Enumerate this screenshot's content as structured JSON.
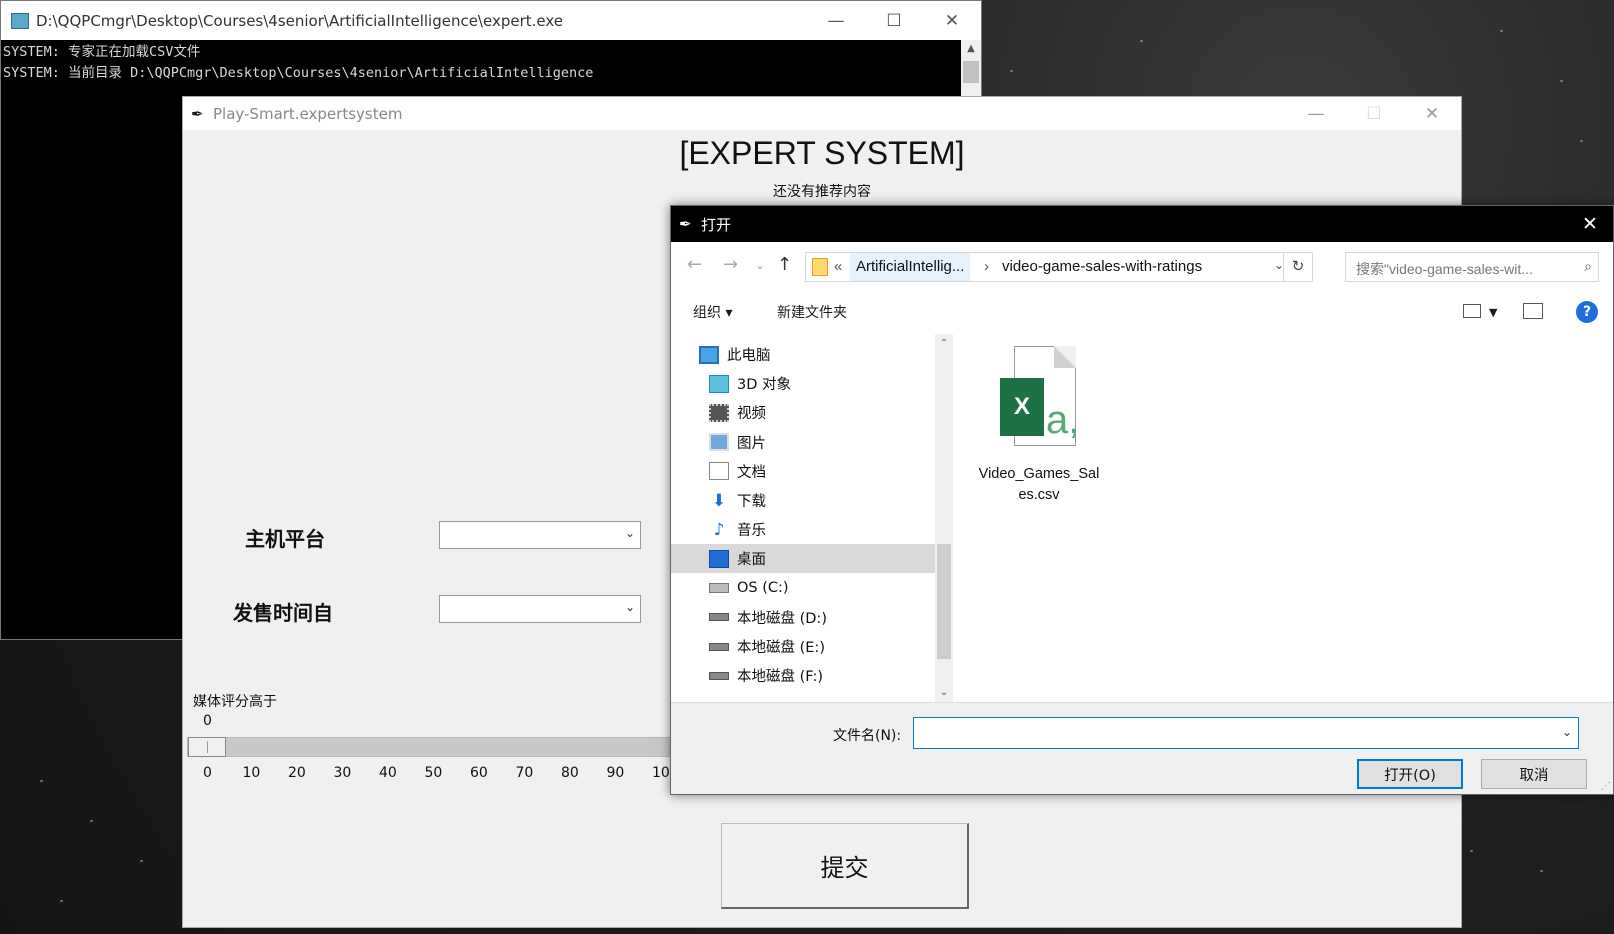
{
  "console": {
    "title": "D:\\QQPCmgr\\Desktop\\Courses\\4senior\\ArtificialIntelligence\\expert.exe",
    "lines": [
      "SYSTEM: 专家正在加载CSV文件",
      "SYSTEM: 当前目录 D:\\QQPCmgr\\Desktop\\Courses\\4senior\\ArtificialIntelligence"
    ]
  },
  "expert": {
    "title": "Play-Smart.expertsystem",
    "heading": "[EXPERT SYSTEM]",
    "subheading": "还没有推荐内容",
    "platform_label": "主机平台",
    "year_label": "发售时间自",
    "slider": {
      "label": "媒体评分高于",
      "value": "0",
      "value_fraction": 0.0,
      "ticks": [
        "0",
        "10",
        "20",
        "30",
        "40",
        "50",
        "60",
        "70",
        "80",
        "90",
        "10"
      ]
    },
    "submit_label": "提交"
  },
  "dialog": {
    "title": "打开",
    "breadcrumb_prefix": "«",
    "breadcrumb": [
      "ArtificialIntellig...",
      "video-game-sales-with-ratings"
    ],
    "search_placeholder": "搜索\"video-game-sales-wit...",
    "toolbar": {
      "organize": "组织 ▾",
      "new_folder": "新建文件夹",
      "help": "?"
    },
    "nav_items": [
      {
        "label": "此电脑",
        "icon": "computer-icon"
      },
      {
        "label": "3D 对象",
        "icon": "cube-3d-icon"
      },
      {
        "label": "视频",
        "icon": "video-icon"
      },
      {
        "label": "图片",
        "icon": "picture-icon"
      },
      {
        "label": "文档",
        "icon": "document-icon"
      },
      {
        "label": "下载",
        "icon": "download-icon"
      },
      {
        "label": "音乐",
        "icon": "music-icon"
      },
      {
        "label": "桌面",
        "icon": "desktop-icon",
        "selected": true
      },
      {
        "label": "OS (C:)",
        "icon": "os-drive-icon"
      },
      {
        "label": "本地磁盘 (D:)",
        "icon": "drive-icon"
      },
      {
        "label": "本地磁盘 (E:)",
        "icon": "drive-icon"
      },
      {
        "label": "本地磁盘 (F:)",
        "icon": "drive-icon"
      }
    ],
    "files": [
      {
        "name": "Video_Games_Sales.csv",
        "icon": "excel-csv-icon"
      }
    ],
    "filename_label": "文件名(N):",
    "filename_value": "",
    "open_label": "打开(O)",
    "cancel_label": "取消"
  },
  "colors": {
    "accent": "#0078d7",
    "excel_green": "#1e7145",
    "console_bg": "#000000",
    "selected_nav": "#d9d9d9"
  }
}
